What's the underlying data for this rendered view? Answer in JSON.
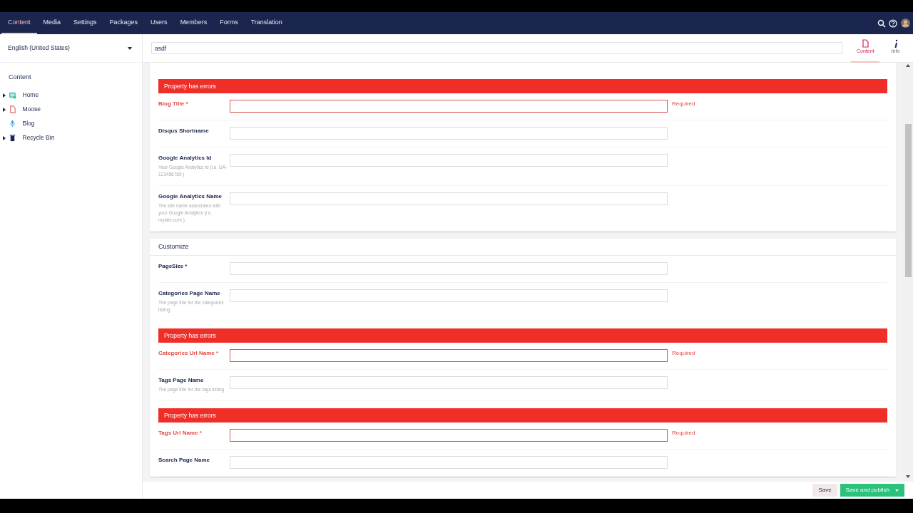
{
  "nav": {
    "tabs": [
      {
        "label": "Content",
        "selected": true
      },
      {
        "label": "Media",
        "selected": false
      },
      {
        "label": "Settings",
        "selected": false
      },
      {
        "label": "Packages",
        "selected": false
      },
      {
        "label": "Users",
        "selected": false
      },
      {
        "label": "Members",
        "selected": false
      },
      {
        "label": "Forms",
        "selected": false
      },
      {
        "label": "Translation",
        "selected": false
      }
    ]
  },
  "sidebar": {
    "language": "English (United States)",
    "section_title": "Content",
    "tree": [
      {
        "label": "Home",
        "kind": "home",
        "expandable": true
      },
      {
        "label": "Moose",
        "kind": "document",
        "expandable": true
      },
      {
        "label": "Blog",
        "kind": "microphone",
        "expandable": false
      },
      {
        "label": "Recycle Bin",
        "kind": "trash",
        "expandable": true
      }
    ]
  },
  "editor": {
    "name": "asdf",
    "apps": [
      {
        "label": "Content",
        "kind": "document",
        "selected": true
      },
      {
        "label": "Info",
        "kind": "info",
        "selected": false
      }
    ]
  },
  "groups": [
    {
      "properties": [
        {
          "label": "Blog Title *",
          "error": true,
          "error_banner": "Property has errors",
          "error_message": "Required"
        },
        {
          "label": "Disqus Shortname",
          "error": false
        },
        {
          "label": "Google Analytics Id",
          "error": false,
          "description": "Your Google Analytics Id (i.e. UA-123456789 )"
        },
        {
          "label": "Google Analytics Name",
          "error": false,
          "description": "The site name associated with your Google Analytics (i.e. mysite.com )"
        }
      ]
    },
    {
      "title": "Customize",
      "properties": [
        {
          "label": "PageSize *",
          "error": false
        },
        {
          "label": "Categories Page Name",
          "error": false,
          "description": "The page title for the categories listing"
        },
        {
          "label": "Categories Url Name *",
          "error": true,
          "error_banner": "Property has errors",
          "error_message": "Required"
        },
        {
          "label": "Tags Page Name",
          "error": false,
          "description": "The page title for the tags listing"
        },
        {
          "label": "Tags Url Name *",
          "error": true,
          "error_banner": "Property has errors",
          "error_message": "Required"
        },
        {
          "label": "Search Page Name",
          "error": false
        }
      ]
    }
  ],
  "footer": {
    "save": "Save",
    "publish": "Save and publish"
  }
}
